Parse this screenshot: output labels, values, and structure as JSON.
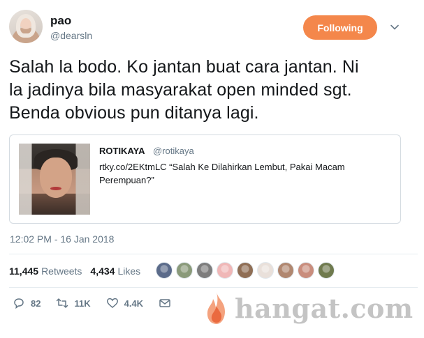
{
  "author": {
    "name": "pao",
    "handle": "@dearsln"
  },
  "follow_button": {
    "label": "Following",
    "color": "#f4874b"
  },
  "tweet": {
    "lines": [
      "Salah la bodo. Ko jantan buat cara jantan. Ni",
      "la jadinya bila masyarakat open minded sgt.",
      "Benda obvious pun ditanya lagi."
    ]
  },
  "quoted_tweet": {
    "name": "ROTIKAYA",
    "handle": "@rotikaya",
    "body_line1": "rtky.co/2EKtmLC “Salah Ke Dilahirkan Lembut, Pakai Macam",
    "body_line2": "Perempuan?”"
  },
  "timestamp": "12:02 PM - 16 Jan 2018",
  "stats": {
    "retweets_count": "11,445",
    "retweets_label": "Retweets",
    "likes_count": "4,434",
    "likes_label": "Likes"
  },
  "liker_avatars": [
    {
      "color": "#5b6b8a"
    },
    {
      "color": "#8a9a7a"
    },
    {
      "color": "#7d7d7d"
    },
    {
      "color": "#f0b7b7"
    },
    {
      "color": "#8f6e55"
    },
    {
      "color": "#e9e0da"
    },
    {
      "color": "#b08770"
    },
    {
      "color": "#c98d7d"
    },
    {
      "color": "#6f7a4e"
    }
  ],
  "actions": {
    "reply_count": "82",
    "retweet_count": "11K",
    "like_count": "4.4K"
  },
  "watermark": {
    "text": "hangat.com"
  }
}
